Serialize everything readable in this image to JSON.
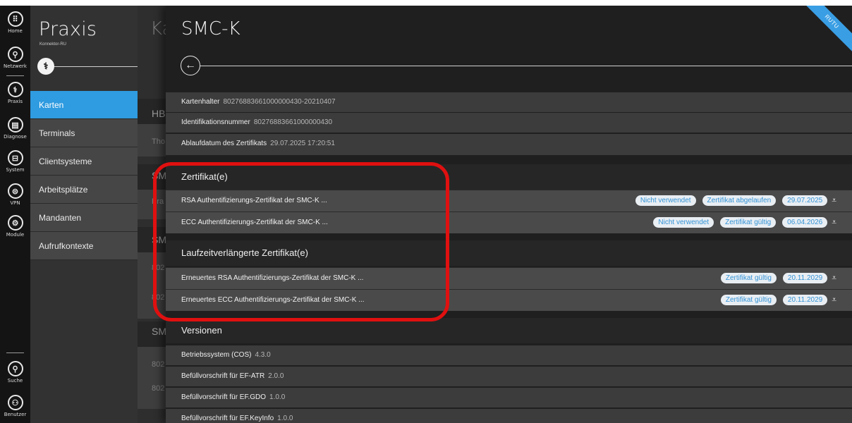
{
  "rail": {
    "items": [
      {
        "label": "Home",
        "icon": "grid-icon",
        "glyph": "⠿"
      },
      {
        "label": "Netzwerk",
        "icon": "network-icon",
        "glyph": "⚲"
      },
      {
        "label": "Praxis",
        "icon": "caduceus-icon",
        "glyph": "⚕"
      },
      {
        "label": "Diagnose",
        "icon": "clipboard-icon",
        "glyph": "▤"
      },
      {
        "label": "System",
        "icon": "drive-icon",
        "glyph": "⊟"
      },
      {
        "label": "VPN",
        "icon": "vpn-icon",
        "glyph": "⊜"
      },
      {
        "label": "Module",
        "icon": "modules-icon",
        "glyph": "⚙"
      }
    ],
    "bottom": [
      {
        "label": "Suche",
        "icon": "search-icon",
        "glyph": "⚲"
      },
      {
        "label": "Benutzer",
        "icon": "user-icon",
        "glyph": "⚇"
      }
    ]
  },
  "nav": {
    "title": "Praxis",
    "subtitle": "Konnektor-RU",
    "badge_glyph": "⚕",
    "items": [
      {
        "label": "Karten",
        "active": true
      },
      {
        "label": "Terminals",
        "active": false
      },
      {
        "label": "Clientsysteme",
        "active": false
      },
      {
        "label": "Arbeitsplätze",
        "active": false
      },
      {
        "label": "Mandanten",
        "active": false
      },
      {
        "label": "Aufrufkontexte",
        "active": false
      }
    ]
  },
  "under": {
    "title": "Ka",
    "texts": [
      "HB",
      "Tho",
      "SM",
      "Pra",
      "SM",
      "802",
      "802",
      "SM",
      "802",
      "802"
    ]
  },
  "main": {
    "title": "SMC-K",
    "back_glyph": "←",
    "ribbon": "RUTU",
    "info": [
      {
        "label": "Kartenhalter",
        "value": "80276883661000000430-20210407"
      },
      {
        "label": "Identifikationsnummer",
        "value": "80276883661000000430"
      },
      {
        "label": "Ablaufdatum des Zertifikats",
        "value": "29.07.2025 17:20:51"
      }
    ],
    "section_certs": "Zertifikat(e)",
    "certs": [
      {
        "name": "RSA Authentifizierungs-Zertifikat der SMC-K ...",
        "badges": [
          "Nicht verwendet",
          "Zertifikat abgelaufen",
          "29.07.2025"
        ]
      },
      {
        "name": "ECC Authentifizierungs-Zertifikat der SMC-K ...",
        "badges": [
          "Nicht verwendet",
          "Zertifikat gültig",
          "06.04.2026"
        ]
      }
    ],
    "section_extended": "Laufzeitverlängerte Zertifikat(e)",
    "extended": [
      {
        "name": "Erneuertes RSA Authentifizierungs-Zertifikat der SMC-K ...",
        "badges": [
          "Zertifikat gültig",
          "20.11.2029"
        ]
      },
      {
        "name": "Erneuertes ECC Authentifizierungs-Zertifikat der SMC-K ...",
        "badges": [
          "Zertifikat gültig",
          "20.11.2029"
        ]
      }
    ],
    "download_glyph": "⩡",
    "section_versions": "Versionen",
    "versions": [
      {
        "label": "Betriebssystem (COS)",
        "value": "4.3.0"
      },
      {
        "label": "Befüllvorschrift für EF-ATR",
        "value": "2.0.0"
      },
      {
        "label": "Befüllvorschrift für EF.GDO",
        "value": "1.0.0"
      },
      {
        "label": "Befüllvorschrift für EF.KeyInfo",
        "value": "1.0.0"
      }
    ]
  },
  "colors": {
    "accent": "#2f9be0",
    "highlight": "#e01010",
    "pill_text": "#3493d6"
  }
}
